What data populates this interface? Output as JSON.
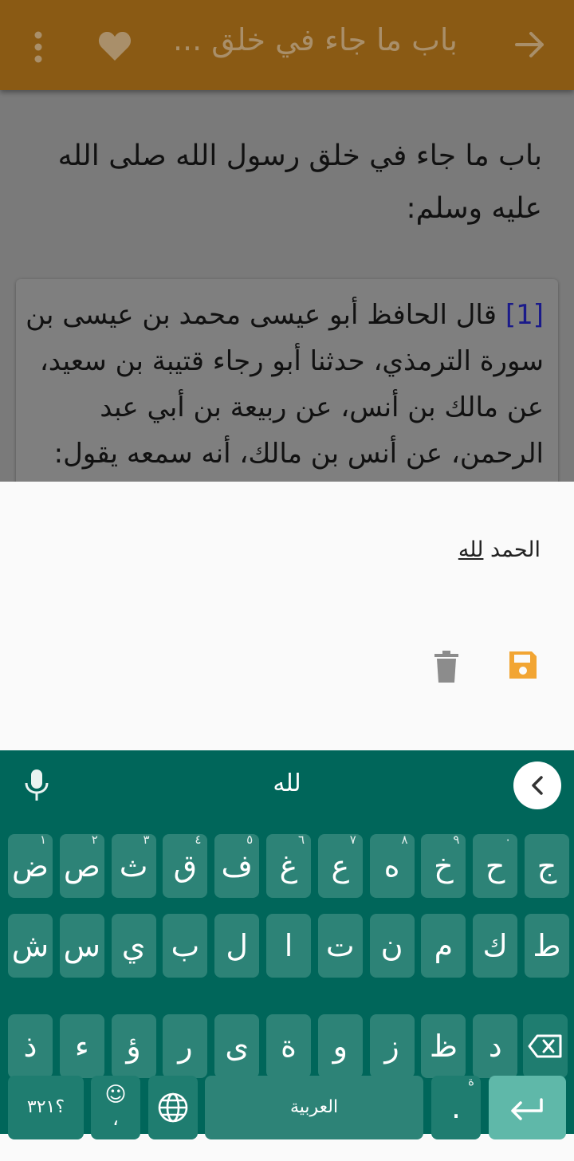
{
  "appbar": {
    "title": "باب ما جاء في خلق ..."
  },
  "content": {
    "chapter_title": "باب ما جاء في خلق رسول الله صلى الله عليه وسلم:",
    "hadith_number": "[1]",
    "hadith_text": "قال الحافظ أبو عيسى محمد بن عيسى بن سورة الترمذي، حدثنا أبو رجاء قتيبة بن سعيد، عن مالك بن أنس، عن ربيعة بن أبي عبد الرحمن، عن أنس بن مالك، أنه سمعه يقول:"
  },
  "note": {
    "word1": "الحمد",
    "word2": "لله"
  },
  "keyboard": {
    "suggestion": "لله",
    "row1": [
      {
        "ch": "ض",
        "hint": "١"
      },
      {
        "ch": "ص",
        "hint": "٢"
      },
      {
        "ch": "ث",
        "hint": "٣"
      },
      {
        "ch": "ق",
        "hint": "٤"
      },
      {
        "ch": "ف",
        "hint": "٥"
      },
      {
        "ch": "غ",
        "hint": "٦"
      },
      {
        "ch": "ع",
        "hint": "٧"
      },
      {
        "ch": "ه",
        "hint": "٨"
      },
      {
        "ch": "خ",
        "hint": "٩"
      },
      {
        "ch": "ح",
        "hint": "٠"
      },
      {
        "ch": "ج",
        "hint": ""
      }
    ],
    "row2": [
      "ش",
      "س",
      "ي",
      "ب",
      "ل",
      "ا",
      "ت",
      "ن",
      "م",
      "ك",
      "ط"
    ],
    "row3": [
      "ذ",
      "ء",
      "ؤ",
      "ر",
      "ى",
      "ة",
      "و",
      "ز",
      "ظ",
      "د"
    ],
    "numbers_label": "؟٣٢١",
    "emoji_label": "☺",
    "comma": "،",
    "space_label": "العربية",
    "period": ".",
    "period_hint": "ة"
  },
  "colors": {
    "appbar": "#8a5a14",
    "keyboard": "#00665a",
    "key": "#2d8377",
    "enter": "#5fb8a9",
    "save": "#f2a533"
  }
}
